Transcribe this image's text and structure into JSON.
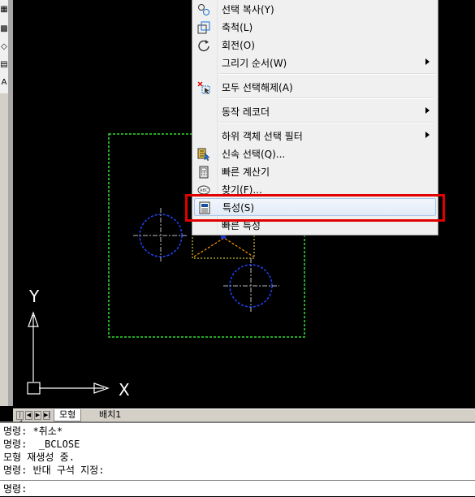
{
  "menu": {
    "items": [
      {
        "label": "선택 복사(Y)",
        "icon": "copy-selection-icon",
        "submenu": false
      },
      {
        "label": "축척(L)",
        "icon": "scale-icon",
        "submenu": false
      },
      {
        "label": "회전(O)",
        "icon": "rotate-icon",
        "submenu": false
      },
      {
        "label": "그리기 순서(W)",
        "icon": "",
        "submenu": true
      },
      {
        "label": "모두 선택해제(A)",
        "icon": "deselect-all-icon",
        "submenu": false
      },
      {
        "label": "동작 레코더",
        "icon": "",
        "submenu": true
      },
      {
        "label": "하위 객체 선택 필터",
        "icon": "",
        "submenu": true
      },
      {
        "label": "신속 선택(Q)...",
        "icon": "quick-select-icon",
        "submenu": false
      },
      {
        "label": "빠른 계산기",
        "icon": "calculator-icon",
        "submenu": false
      },
      {
        "label": "찾기(F)...",
        "icon": "find-icon",
        "submenu": false
      },
      {
        "label": "특성(S)",
        "icon": "properties-icon",
        "submenu": false,
        "highlighted": true
      },
      {
        "label": "빠른 특성",
        "icon": "",
        "submenu": false
      }
    ]
  },
  "ucs": {
    "x_label": "X",
    "y_label": "Y"
  },
  "tabs": {
    "model": "모형",
    "layout1": "배치1"
  },
  "command": {
    "history": [
      "명령: *취소*",
      "명령:  _BCLOSE",
      "모형 재생성 중.",
      "명령: 반대 구석 지정:"
    ],
    "prompt": "명령:"
  },
  "colors": {
    "highlight_box": "#e00000",
    "selection_dashed": "#33dd33",
    "circle": "#2244ff"
  }
}
